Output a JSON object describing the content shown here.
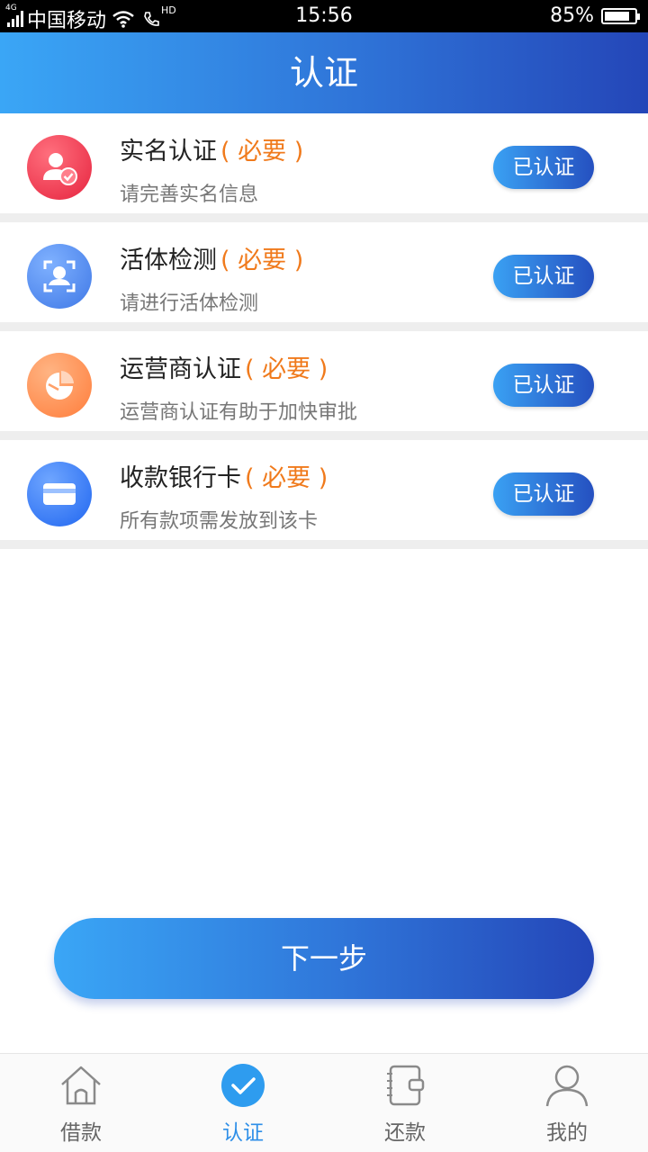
{
  "status_bar": {
    "network": "4G",
    "carrier": "中国移动",
    "call_badge": "HD",
    "time": "15:56",
    "battery": "85%",
    "battery_level": 0.85
  },
  "header": {
    "title": "认证"
  },
  "items": [
    {
      "title": "实名认证",
      "required": "( 必要 )",
      "subtitle": "请完善实名信息",
      "button": "已认证",
      "icon": "user-verified-icon",
      "color": "#ef3248"
    },
    {
      "title": "活体检测",
      "required": "( 必要 )",
      "subtitle": "请进行活体检测",
      "button": "已认证",
      "icon": "face-scan-icon",
      "color": "#4a82ec"
    },
    {
      "title": "运营商认证",
      "required": "( 必要 )",
      "subtitle": "运营商认证有助于加快审批",
      "button": "已认证",
      "icon": "pie-chart-icon",
      "color": "#ff8a4a"
    },
    {
      "title": "收款银行卡",
      "required": "( 必要 )",
      "subtitle": "所有款项需发放到该卡",
      "button": "已认证",
      "icon": "bank-card-icon",
      "color": "#2c70f2"
    }
  ],
  "next_button": "下一步",
  "tabbar": {
    "tabs": [
      {
        "label": "借款",
        "icon": "home-icon"
      },
      {
        "label": "认证",
        "icon": "check-circle-icon"
      },
      {
        "label": "还款",
        "icon": "wallet-icon"
      },
      {
        "label": "我的",
        "icon": "person-icon"
      }
    ],
    "active": "认证"
  }
}
